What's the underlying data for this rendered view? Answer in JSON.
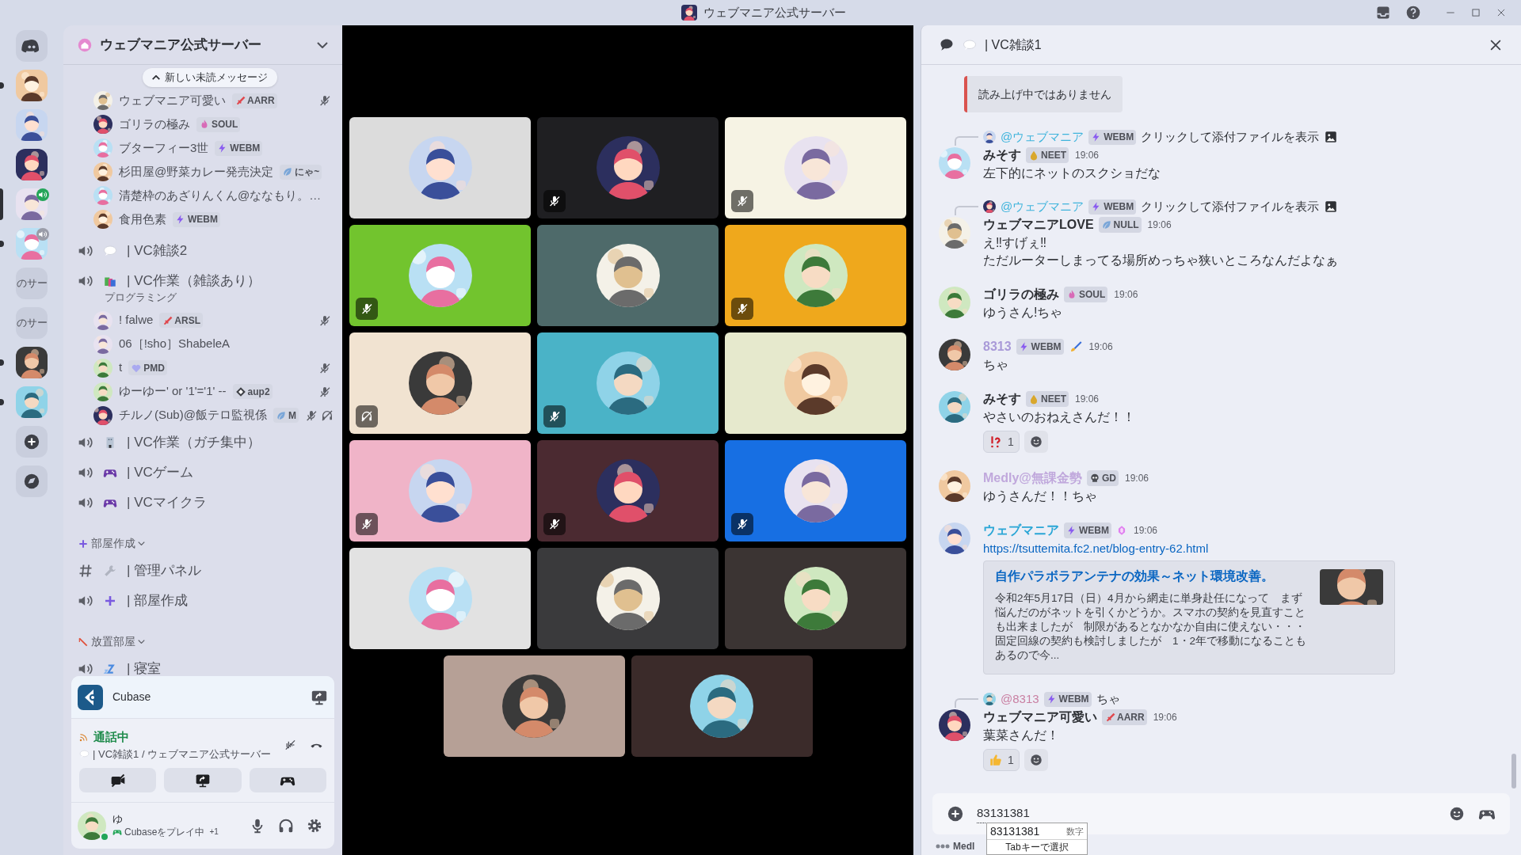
{
  "window": {
    "title": "ウェブマニア公式サーバー"
  },
  "servers": [
    {
      "kind": "home",
      "selected": false,
      "unread": false
    },
    {
      "kind": "picture",
      "selected": false,
      "unread": true
    },
    {
      "kind": "picture",
      "selected": false,
      "unread": false
    },
    {
      "kind": "picture",
      "selected": false,
      "unread": false
    },
    {
      "kind": "picture",
      "selected": true,
      "unread": false,
      "color": "#23a559"
    },
    {
      "kind": "picture",
      "selected": false,
      "unread": true,
      "color": "#9a9ca8"
    },
    {
      "kind": "text",
      "label": "のサー",
      "selected": false,
      "unread": false
    },
    {
      "kind": "text",
      "label": "のサー",
      "selected": false,
      "unread": false
    },
    {
      "kind": "picture",
      "selected": false,
      "unread": true
    },
    {
      "kind": "picture",
      "selected": false,
      "unread": true
    },
    {
      "kind": "add",
      "selected": false,
      "unread": false
    },
    {
      "kind": "explore",
      "selected": false,
      "unread": false
    }
  ],
  "server_header": {
    "name": "ウェブマニア公式サーバー"
  },
  "new_messages_pill": "新しい未読メッセージ",
  "channels": [
    {
      "kind": "members",
      "members": [
        {
          "name": "ウェブマニア可愛い",
          "badge": {
            "text": "AARR",
            "kind": "sword"
          },
          "muted": true,
          "deafened": false
        },
        {
          "name": "ゴリラの極み",
          "badge": {
            "text": "SOUL",
            "kind": "flame"
          },
          "muted": false,
          "deafened": false
        },
        {
          "name": "ブターフィー3世",
          "badge": {
            "text": "WEBM",
            "kind": "bolt"
          },
          "muted": false,
          "deafened": false
        },
        {
          "name": "杉田屋@野菜カレー発売決定",
          "badge": {
            "text": "にゃ~",
            "kind": "leaf"
          },
          "muted": false,
          "deafened": false
        },
        {
          "name": "清楚枠のあざりんくん@ななもり。…",
          "muted": false,
          "deafened": false
        },
        {
          "name": "食用色素",
          "badge": {
            "text": "WEBM",
            "kind": "bolt"
          },
          "muted": false,
          "deafened": false
        }
      ]
    },
    {
      "kind": "voice",
      "name": "| VC雑談2"
    },
    {
      "kind": "voice",
      "name": "| VC作業（雑談あり）",
      "topic": "プログラミング",
      "members": [
        {
          "name": "! falwe",
          "badge": {
            "text": "ARSL",
            "kind": "sword"
          },
          "muted": true,
          "deafened": false
        },
        {
          "name": "06［!sho］ShabeleA",
          "muted": false,
          "deafened": false
        },
        {
          "name": "t",
          "badge": {
            "text": "PMD",
            "kind": "heart"
          },
          "muted": true,
          "deafened": false
        },
        {
          "name": "ゆーゆー' or '1'='1' --",
          "badge": {
            "text": "aup2",
            "kind": "diamond"
          },
          "muted": true,
          "deafened": false
        },
        {
          "name": "チルノ(Sub)@飯テロ監視係",
          "badge": {
            "text": "M",
            "kind": "leaf"
          },
          "muted": true,
          "deafened": true
        }
      ]
    },
    {
      "kind": "voice",
      "name": "| VC作業（ガチ集中）"
    },
    {
      "kind": "voice",
      "name": "| VCゲーム"
    },
    {
      "kind": "voice",
      "name": "| VCマイクラ"
    },
    {
      "kind": "category",
      "name": "部屋作成"
    },
    {
      "kind": "text",
      "name": "| 管理パネル"
    },
    {
      "kind": "voice",
      "name": "| 部屋作成"
    },
    {
      "kind": "category",
      "name": "放置部屋"
    },
    {
      "kind": "voice",
      "name": "| 寝室"
    }
  ],
  "activity": {
    "app": "Cubase"
  },
  "voice_status": {
    "status": "通話中",
    "channel": "| VC雑談1 / ウェブマニア公式サーバー"
  },
  "user": {
    "name": "ゆ",
    "activity": "Cubaseをプレイ中",
    "extra": "+1",
    "online": true
  },
  "tiles": [
    {
      "color": "#dcdcdc",
      "muted": false,
      "deafened": false
    },
    {
      "color": "#1f1f22",
      "muted": true,
      "deafened": false
    },
    {
      "color": "#f6f3e4",
      "muted": true,
      "deafened": false
    },
    {
      "color": "#72c42e",
      "muted": true,
      "deafened": false
    },
    {
      "color": "#4e6a6a",
      "muted": false,
      "deafened": false
    },
    {
      "color": "#efa81c",
      "muted": true,
      "deafened": false
    },
    {
      "color": "#f1e3d1",
      "muted": false,
      "deafened": true
    },
    {
      "color": "#4ab3c7",
      "muted": true,
      "deafened": false
    },
    {
      "color": "#e6e9cd",
      "muted": false,
      "deafened": false
    },
    {
      "color": "#f0b4c8",
      "muted": true,
      "deafened": false
    },
    {
      "color": "#4b2a31",
      "muted": true,
      "deafened": false
    },
    {
      "color": "#176fe3",
      "muted": true,
      "deafened": false
    },
    {
      "color": "#e2e2e2",
      "muted": false,
      "deafened": false
    },
    {
      "color": "#3a3a3c",
      "muted": false,
      "deafened": false
    },
    {
      "color": "#3b3433",
      "muted": false,
      "deafened": false
    },
    {
      "color": "#b6a096",
      "muted": false,
      "deafened": false
    },
    {
      "color": "#3b2b2a",
      "muted": false,
      "deafened": false
    }
  ],
  "chat": {
    "title": "| VC雑談1",
    "messages": [
      {
        "kind": "embed",
        "text": "読み上げ中ではありません"
      },
      {
        "kind": "message",
        "reply": {
          "author": "@ウェブマニア",
          "color": "#3fb4dc",
          "badge": {
            "text": "WEBM",
            "kind": "bolt"
          },
          "text": "クリックして添付ファイルを表示",
          "attachment": true
        },
        "author": "みそす",
        "color": "#2e3035",
        "badges": [
          {
            "text": "NEET",
            "kind": "drop"
          }
        ],
        "time": "19:06",
        "lines": [
          "左下的にネットのスクショだな"
        ]
      },
      {
        "kind": "message",
        "reply": {
          "author": "@ウェブマニア",
          "color": "#3fb4dc",
          "badge": {
            "text": "WEBM",
            "kind": "bolt"
          },
          "text": "クリックして添付ファイルを表示",
          "attachment": true
        },
        "author": "ウェブマニアLOVE",
        "color": "#2e3035",
        "badges": [
          {
            "text": "NULL",
            "kind": "leaf"
          }
        ],
        "time": "19:06",
        "lines": [
          "え‼すげぇ‼",
          "ただルーターしまってる場所めっちゃ狭いところなんだよなぁ"
        ]
      },
      {
        "kind": "message",
        "author": "ゴリラの極み",
        "color": "#2e3035",
        "badges": [
          {
            "text": "SOUL",
            "kind": "flame"
          }
        ],
        "time": "19:06",
        "lines": [
          "ゆうさん!ちゃ"
        ]
      },
      {
        "kind": "message",
        "author": "8313",
        "color": "#a99ad8",
        "badges": [
          {
            "text": "WEBM",
            "kind": "bolt"
          },
          {
            "kind": "brush"
          }
        ],
        "time": "19:06",
        "lines": [
          "ちゃ"
        ]
      },
      {
        "kind": "message",
        "author": "みそす",
        "color": "#2e3035",
        "badges": [
          {
            "text": "NEET",
            "kind": "drop"
          }
        ],
        "time": "19:06",
        "lines": [
          "やさいのおねえさんだ！！"
        ],
        "reactions": [
          {
            "kind": "interrobang",
            "count": "1"
          }
        ]
      },
      {
        "kind": "message",
        "author": "Medly@無課金勢",
        "color": "#c0a8dc",
        "badges": [
          {
            "text": "GD",
            "kind": "skull"
          }
        ],
        "time": "19:06",
        "lines": [
          "ゆうさんだ！！ちゃ"
        ]
      },
      {
        "kind": "message",
        "author": "ウェブマニア",
        "color": "#2aa6d6",
        "badges": [
          {
            "text": "WEBM",
            "kind": "bolt"
          },
          {
            "kind": "gem"
          }
        ],
        "time": "19:06",
        "link": "https://tsuttemita.fc2.net/blog-entry-62.html",
        "link_embed": {
          "title": "自作パラボラアンテナの効果～ネット環境改善。",
          "description": "令和2年5月17日（日）4月から網走に単身赴任になって　まず悩んだのがネットを引くかどうか。スマホの契約を見直すことも出来ましたが　制限があるとなかなか自由に使えない・・・固定回線の契約も検討しましたが　1・2年で移動になることもあるので今...",
          "thumbnail": {
            "kind": "picture"
          }
        }
      },
      {
        "kind": "message",
        "reply": {
          "author": "@8313",
          "color": "#c97fa2",
          "badge": {
            "text": "WEBM",
            "kind": "bolt"
          },
          "text": "ちゃ",
          "attachment": false
        },
        "author": "ウェブマニア可愛い",
        "color": "#2e3035",
        "badges": [
          {
            "text": "AARR",
            "kind": "sword"
          }
        ],
        "time": "19:06",
        "lines": [
          "葉菜さんだ！"
        ],
        "reactions": [
          {
            "kind": "thumbs",
            "count": "1"
          }
        ]
      }
    ],
    "input": {
      "value": "83131381"
    },
    "ime": {
      "candidate": "83131381",
      "hint": "数字",
      "footer": "Tabキーで選択"
    },
    "typing": "Medl"
  }
}
